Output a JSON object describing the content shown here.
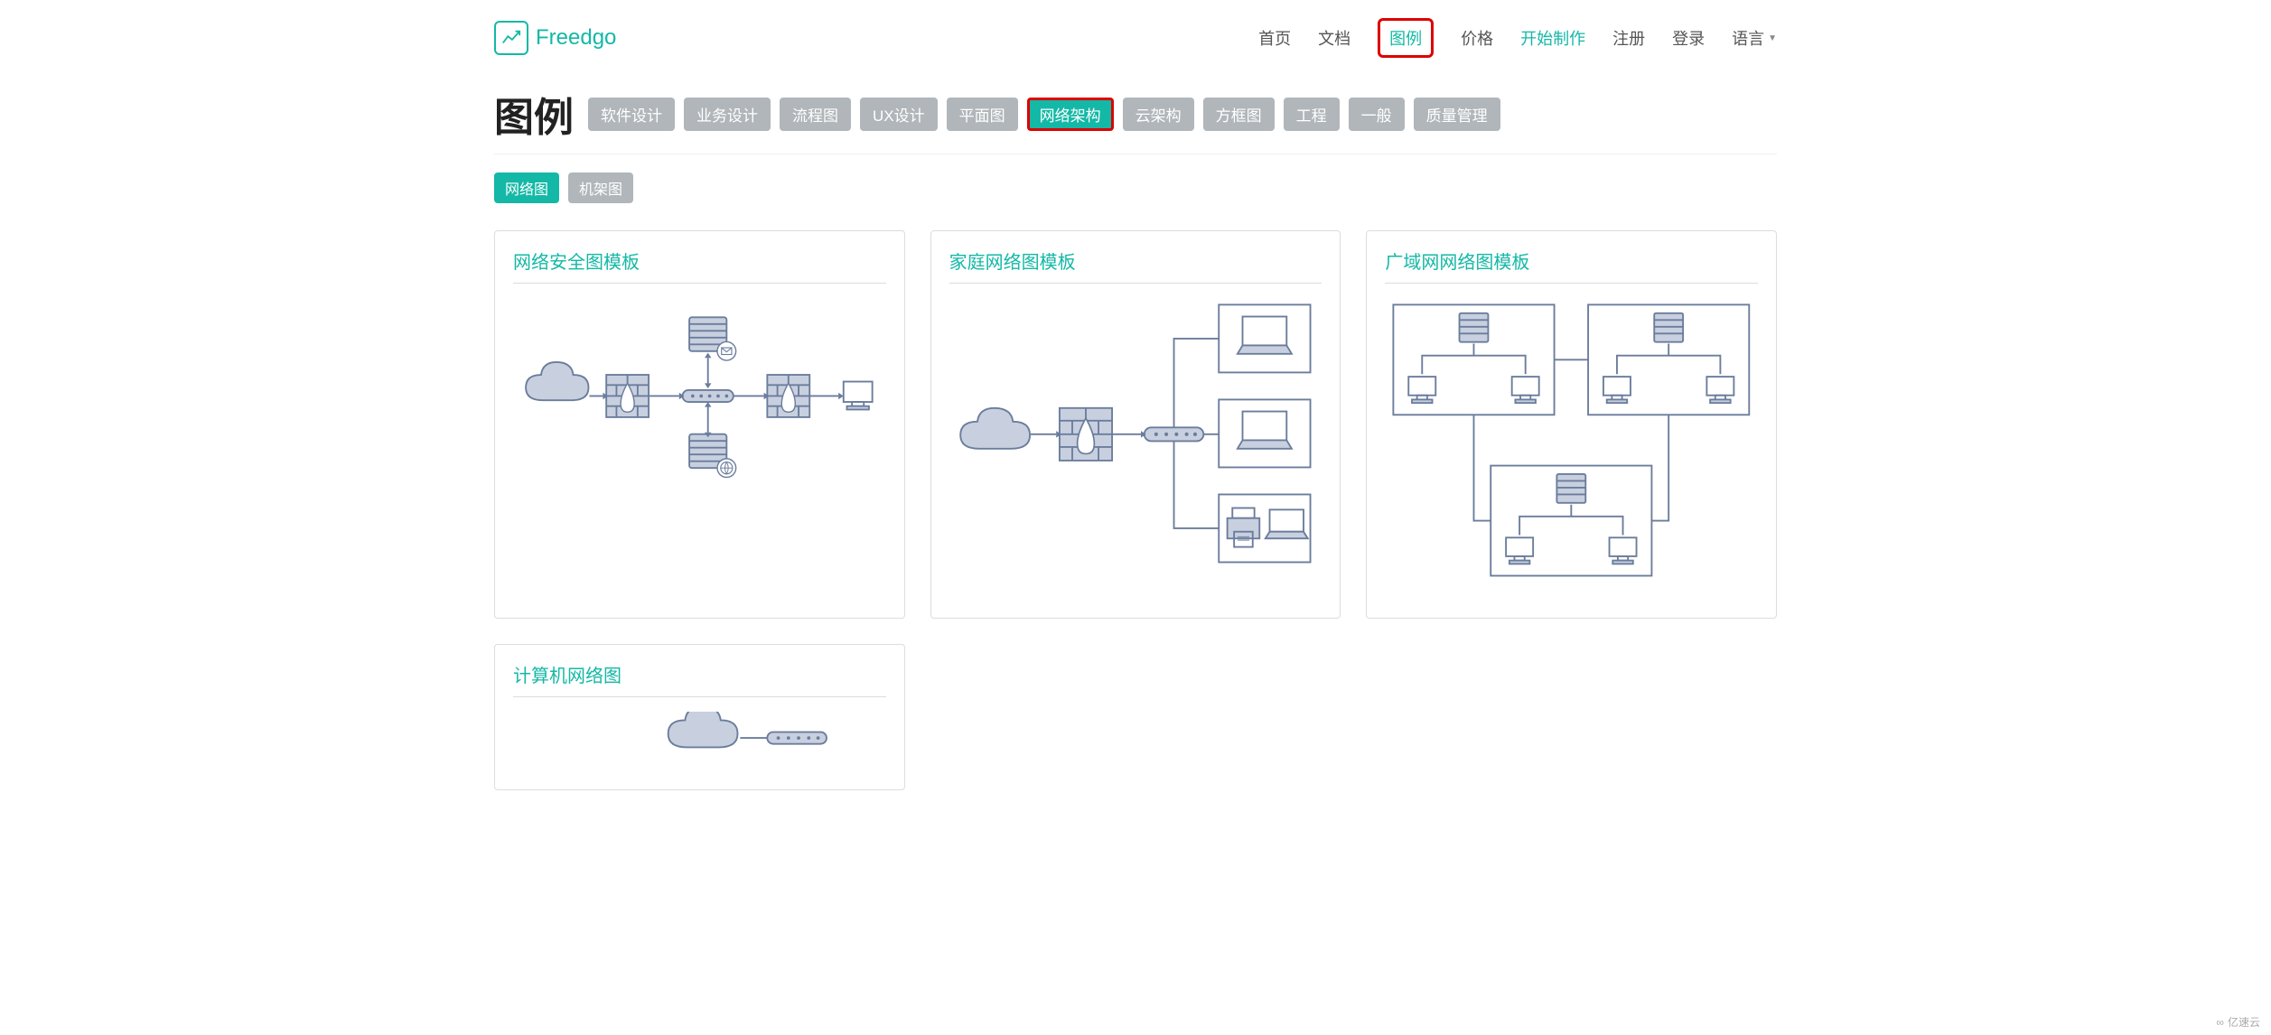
{
  "brand": {
    "name": "Freedgo"
  },
  "nav": {
    "items": [
      {
        "label": "首页",
        "active": false,
        "highlight": false
      },
      {
        "label": "文档",
        "active": false,
        "highlight": false
      },
      {
        "label": "图例",
        "active": true,
        "highlight": true
      },
      {
        "label": "价格",
        "active": false,
        "highlight": false
      },
      {
        "label": "开始制作",
        "active": true,
        "highlight": false
      },
      {
        "label": "注册",
        "active": false,
        "highlight": false
      },
      {
        "label": "登录",
        "active": false,
        "highlight": false
      }
    ],
    "language_label": "语言"
  },
  "page_title": "图例",
  "categories": [
    {
      "label": "软件设计",
      "active": false,
      "highlight": false
    },
    {
      "label": "业务设计",
      "active": false,
      "highlight": false
    },
    {
      "label": "流程图",
      "active": false,
      "highlight": false
    },
    {
      "label": "UX设计",
      "active": false,
      "highlight": false
    },
    {
      "label": "平面图",
      "active": false,
      "highlight": false
    },
    {
      "label": "网络架构",
      "active": true,
      "highlight": true
    },
    {
      "label": "云架构",
      "active": false,
      "highlight": false
    },
    {
      "label": "方框图",
      "active": false,
      "highlight": false
    },
    {
      "label": "工程",
      "active": false,
      "highlight": false
    },
    {
      "label": "一般",
      "active": false,
      "highlight": false
    },
    {
      "label": "质量管理",
      "active": false,
      "highlight": false
    }
  ],
  "sub_categories": [
    {
      "label": "网络图",
      "active": true
    },
    {
      "label": "机架图",
      "active": false
    }
  ],
  "cards": [
    {
      "title": "网络安全图模板",
      "preview": "network-security"
    },
    {
      "title": "家庭网络图模板",
      "preview": "home-network"
    },
    {
      "title": "广域网网络图模板",
      "preview": "wan-network"
    },
    {
      "title": "计算机网络图",
      "preview": "computer-network"
    }
  ],
  "watermark": "亿速云",
  "colors": {
    "accent": "#14b8a6",
    "tag_bg": "#b0b6ba",
    "highlight_border": "#d00"
  },
  "icon_names": {
    "cloud": "cloud-icon",
    "firewall": "firewall-icon",
    "router": "router-icon",
    "server": "server-icon",
    "desktop": "desktop-icon",
    "laptop": "laptop-icon",
    "printer": "printer-icon",
    "mail-badge": "mail-badge-icon",
    "globe-badge": "globe-badge-icon"
  }
}
